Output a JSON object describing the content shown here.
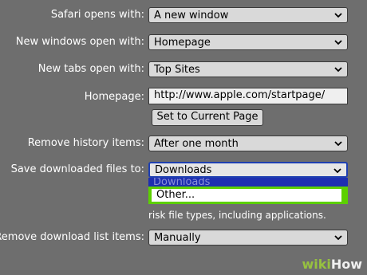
{
  "settings": {
    "opens_with": {
      "label": "Safari opens with:",
      "value": "A new window"
    },
    "new_windows": {
      "label": "New windows open with:",
      "value": "Homepage"
    },
    "new_tabs": {
      "label": "New tabs open with:",
      "value": "Top Sites"
    },
    "homepage": {
      "label": "Homepage:",
      "value": "http://www.apple.com/startpage/"
    },
    "set_current_button": "Set to Current Page",
    "remove_history": {
      "label": "Remove history items:",
      "value": "After one month"
    },
    "save_downloads": {
      "label": "Save downloaded files to:",
      "value": "Downloads"
    },
    "dropdown_options": [
      "Downloads",
      "Other..."
    ],
    "partial_text": "risk file types, including applications.",
    "remove_download_list": {
      "label": "Remove download list items:",
      "value": "Manually"
    }
  },
  "watermark": {
    "prefix": "wiki",
    "suffix": "How"
  },
  "colors": {
    "background": "#6e6e6e",
    "highlight_green": "#5cd000",
    "selected_blue": "#1e2fb0"
  }
}
